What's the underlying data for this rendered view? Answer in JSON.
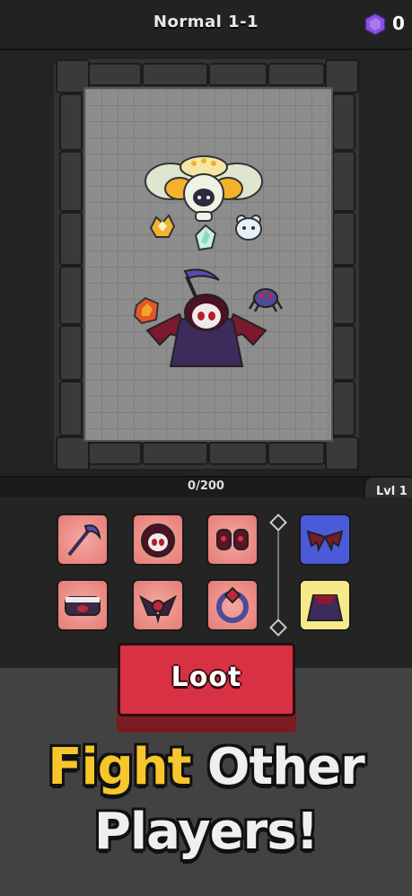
{
  "header": {
    "title": "Normal 1-1",
    "gem_count": "0"
  },
  "progress": {
    "text": "0/200",
    "value": 0,
    "max": 200,
    "level_label": "Lvl 1"
  },
  "inventory": {
    "items": [
      {
        "name": "scythe",
        "icon": "scythe-icon",
        "rarity": "red"
      },
      {
        "name": "hood",
        "icon": "hood-icon",
        "rarity": "red"
      },
      {
        "name": "gloves",
        "icon": "gloves-icon",
        "rarity": "red"
      },
      {
        "name": "wings",
        "icon": "wings-icon",
        "rarity": "blue"
      },
      {
        "name": "belt",
        "icon": "belt-icon",
        "rarity": "red"
      },
      {
        "name": "amulet",
        "icon": "amulet-icon",
        "rarity": "red"
      },
      {
        "name": "ring",
        "icon": "ring-icon",
        "rarity": "red"
      },
      {
        "name": "cloak",
        "icon": "cloak-icon",
        "rarity": "yellow"
      }
    ]
  },
  "loot_button": {
    "label": "Loot"
  },
  "promo": {
    "word1": "Fight",
    "word2": "Other",
    "line2": "Players!"
  },
  "colors": {
    "loot_red": "#d83143",
    "promo_yellow": "#f7c62a",
    "gem_purple": "#8b4fe0",
    "rare_blue": "#4a5ad8",
    "legend_yellow": "#f7e98a",
    "common_red": "#e47c75"
  }
}
